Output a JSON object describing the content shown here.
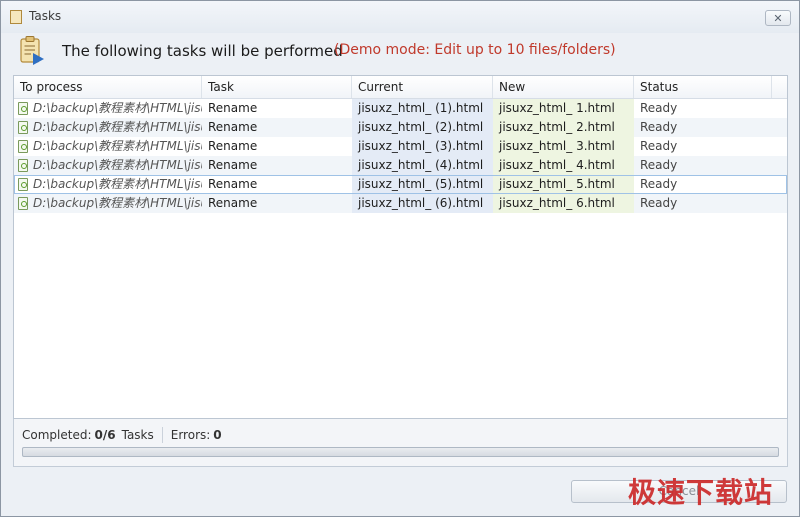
{
  "window": {
    "title": "Tasks",
    "close_label": "✕"
  },
  "header": {
    "title": "The following tasks will be performed",
    "demo_note": "(Demo mode: Edit up to 10 files/folders)"
  },
  "table": {
    "columns": [
      "To process",
      "Task",
      "Current",
      "New",
      "Status"
    ],
    "rows": [
      {
        "path": "D:\\backup\\教程素材\\HTML\\jisu...",
        "task": "Rename",
        "current": "jisuxz_html_ (1).html",
        "new": "jisuxz_html_ 1.html",
        "status": "Ready"
      },
      {
        "path": "D:\\backup\\教程素材\\HTML\\jisu...",
        "task": "Rename",
        "current": "jisuxz_html_ (2).html",
        "new": "jisuxz_html_ 2.html",
        "status": "Ready"
      },
      {
        "path": "D:\\backup\\教程素材\\HTML\\jisu...",
        "task": "Rename",
        "current": "jisuxz_html_ (3).html",
        "new": "jisuxz_html_ 3.html",
        "status": "Ready"
      },
      {
        "path": "D:\\backup\\教程素材\\HTML\\jisu...",
        "task": "Rename",
        "current": "jisuxz_html_ (4).html",
        "new": "jisuxz_html_ 4.html",
        "status": "Ready"
      },
      {
        "path": "D:\\backup\\教程素材\\HTML\\jisu...",
        "task": "Rename",
        "current": "jisuxz_html_ (5).html",
        "new": "jisuxz_html_ 5.html",
        "status": "Ready"
      },
      {
        "path": "D:\\backup\\教程素材\\HTML\\jisu...",
        "task": "Rename",
        "current": "jisuxz_html_ (6).html",
        "new": "jisuxz_html_ 6.html",
        "status": "Ready"
      }
    ]
  },
  "footer": {
    "completed_label": "Completed:",
    "completed_value": "0/6",
    "tasks_label": "Tasks",
    "errors_label": "Errors:",
    "errors_value": "0",
    "progress_fraction": 0
  },
  "buttons": {
    "cancel_label": "Cancel"
  },
  "watermark": "极速下载站",
  "colors": {
    "demo_note": "#c0392b",
    "current_col_bg": "#e4ebf6",
    "new_col_bg": "#eef5e1",
    "watermark": "#cc2a2a"
  },
  "icons": {
    "title": "clipboard-icon",
    "header": "clipboard-play-icon",
    "file": "html-file-icon"
  }
}
